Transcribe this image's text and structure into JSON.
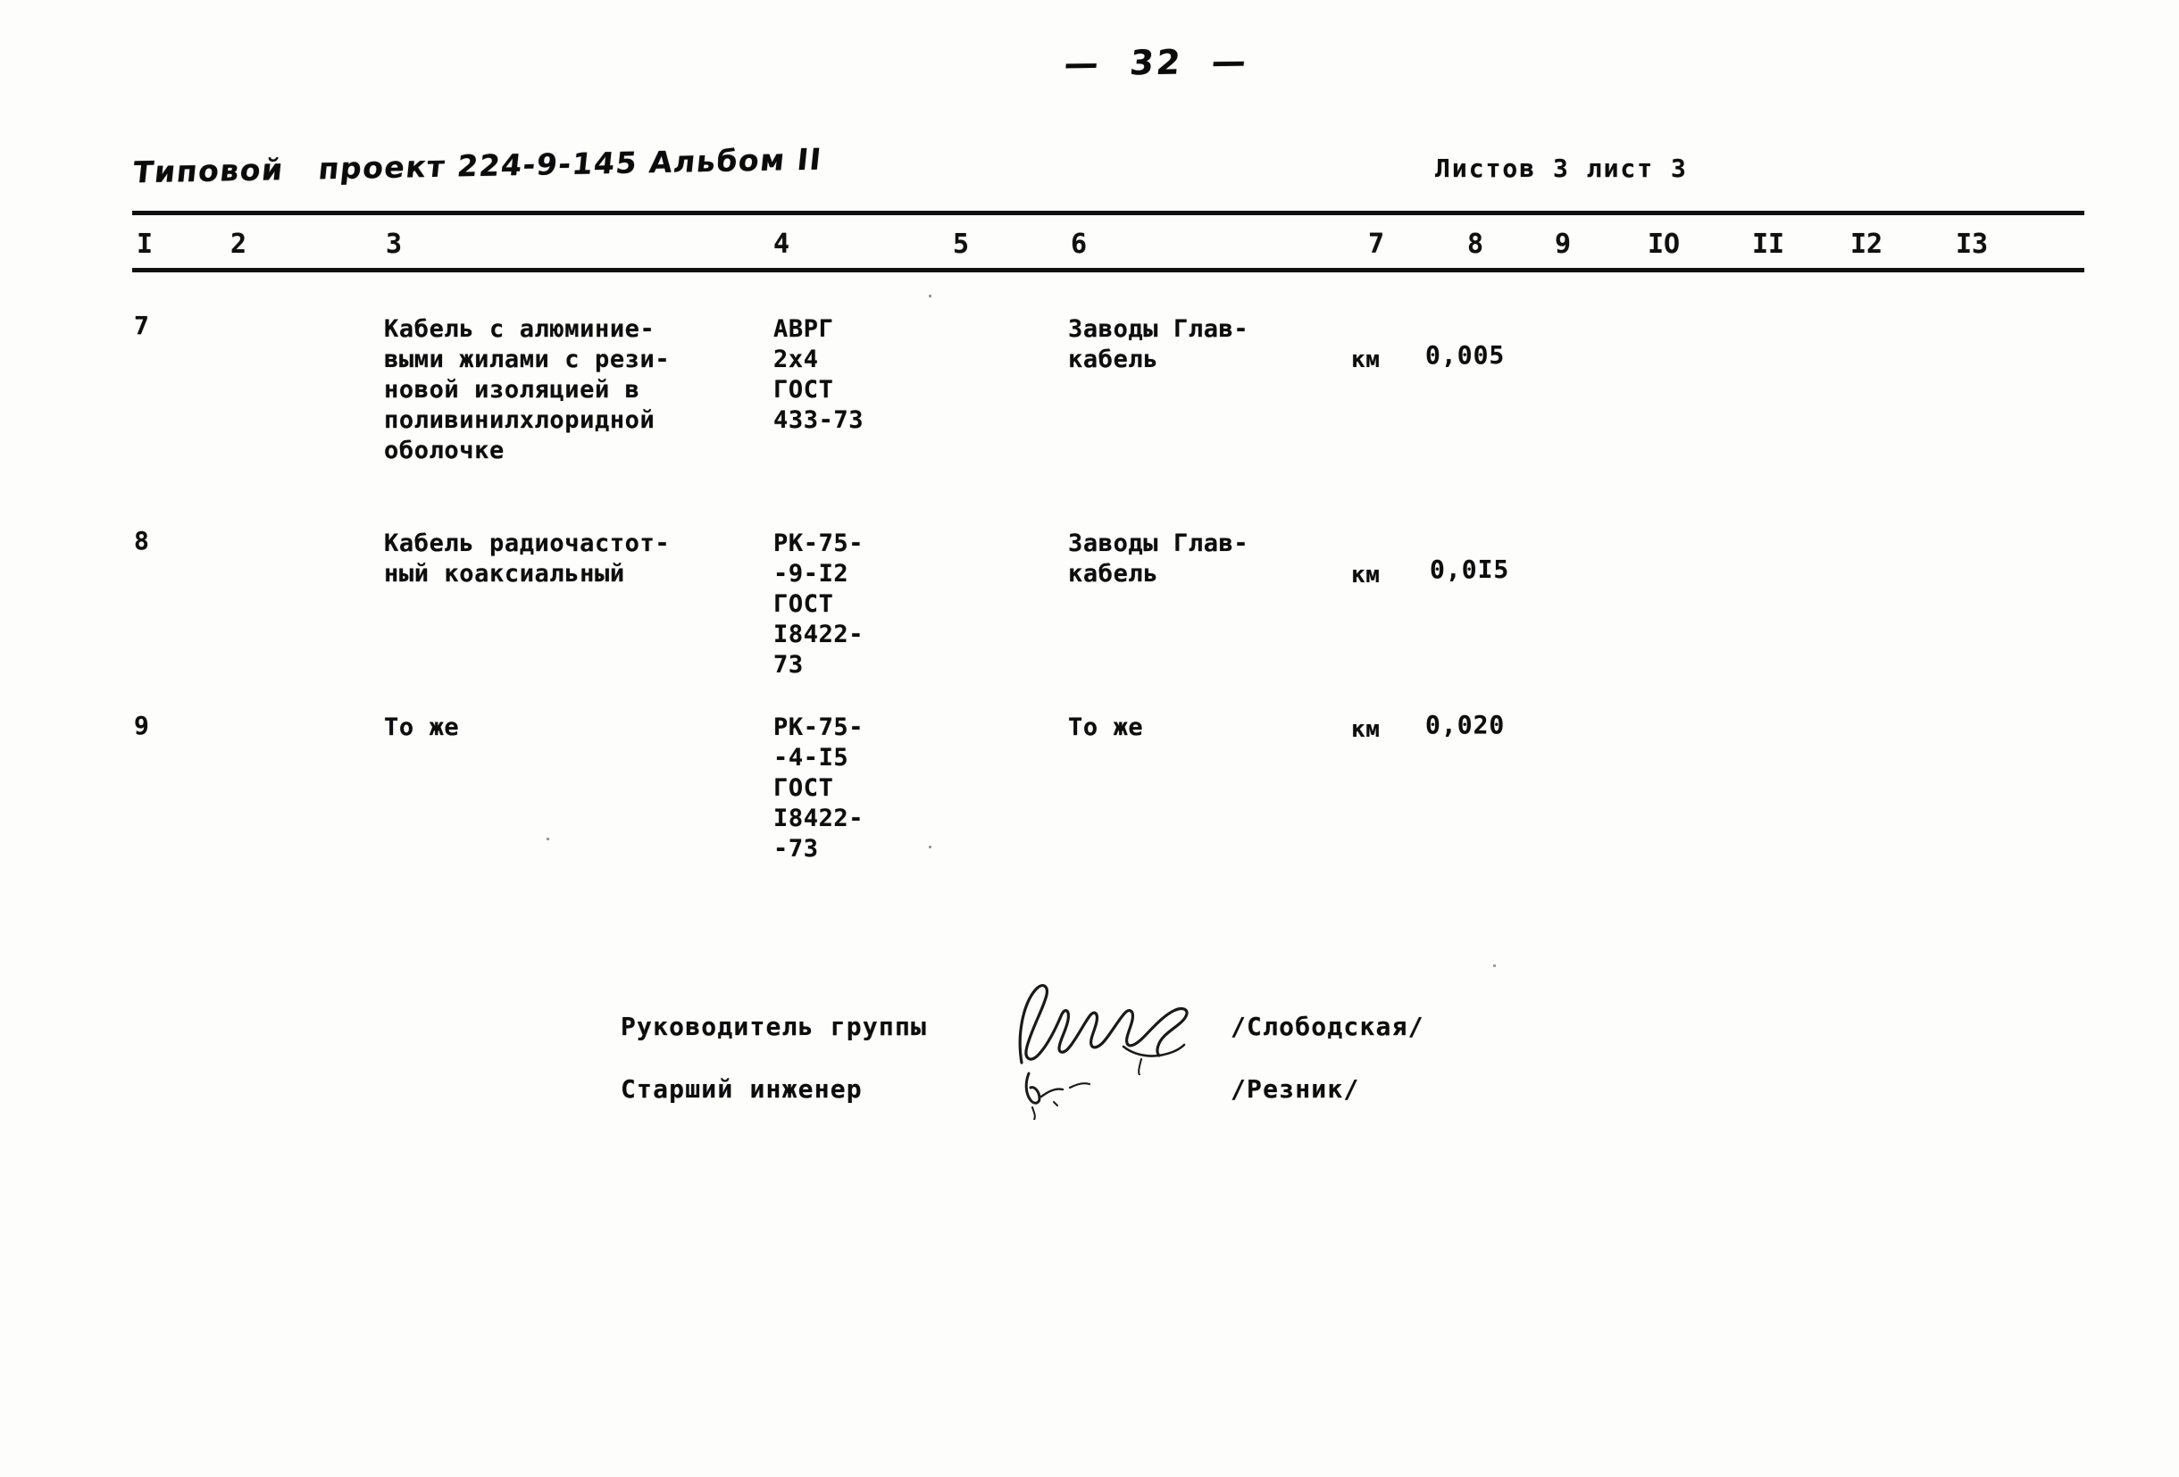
{
  "page": {
    "number_label": "—  32  —"
  },
  "header": {
    "project_line": "Типовой   проект 224-9-145 Альбом II",
    "sheets_info": "Листов 3 лист 3"
  },
  "table": {
    "column_numbers": [
      "I",
      "2",
      "3",
      "4",
      "5",
      "6",
      "7",
      "8",
      "9",
      "IO",
      "II",
      "I2",
      "I3"
    ],
    "rows": [
      {
        "num": "7",
        "name": "Кабель с алюминие-\nвыми жилами с рези-\nновой изоляцией в\nполивинилхлоридной\nоболочке",
        "spec": "АВРГ\n2х4\nГОСТ\n433-73",
        "supplier": "Заводы Глав-\nкабель",
        "unit": "км",
        "qty": "0,005"
      },
      {
        "num": "8",
        "name": "Кабель радиочастот-\nный коаксиальный",
        "spec": "РК-75-\n-9-I2\nГОСТ\nI8422-\n73",
        "supplier": "Заводы Глав-\nкабель",
        "unit": "км",
        "qty": "0,0I5"
      },
      {
        "num": "9",
        "name": "То же",
        "spec": "РК-75-\n-4-I5\nГОСТ\nI8422-\n-73",
        "supplier": "То же",
        "unit": "км",
        "qty": "0,020"
      }
    ]
  },
  "signatures": {
    "rows": [
      {
        "label": "Руководитель группы",
        "name": "/Слободская/"
      },
      {
        "label": "Старший инженер",
        "name": "/Резник/"
      }
    ]
  }
}
